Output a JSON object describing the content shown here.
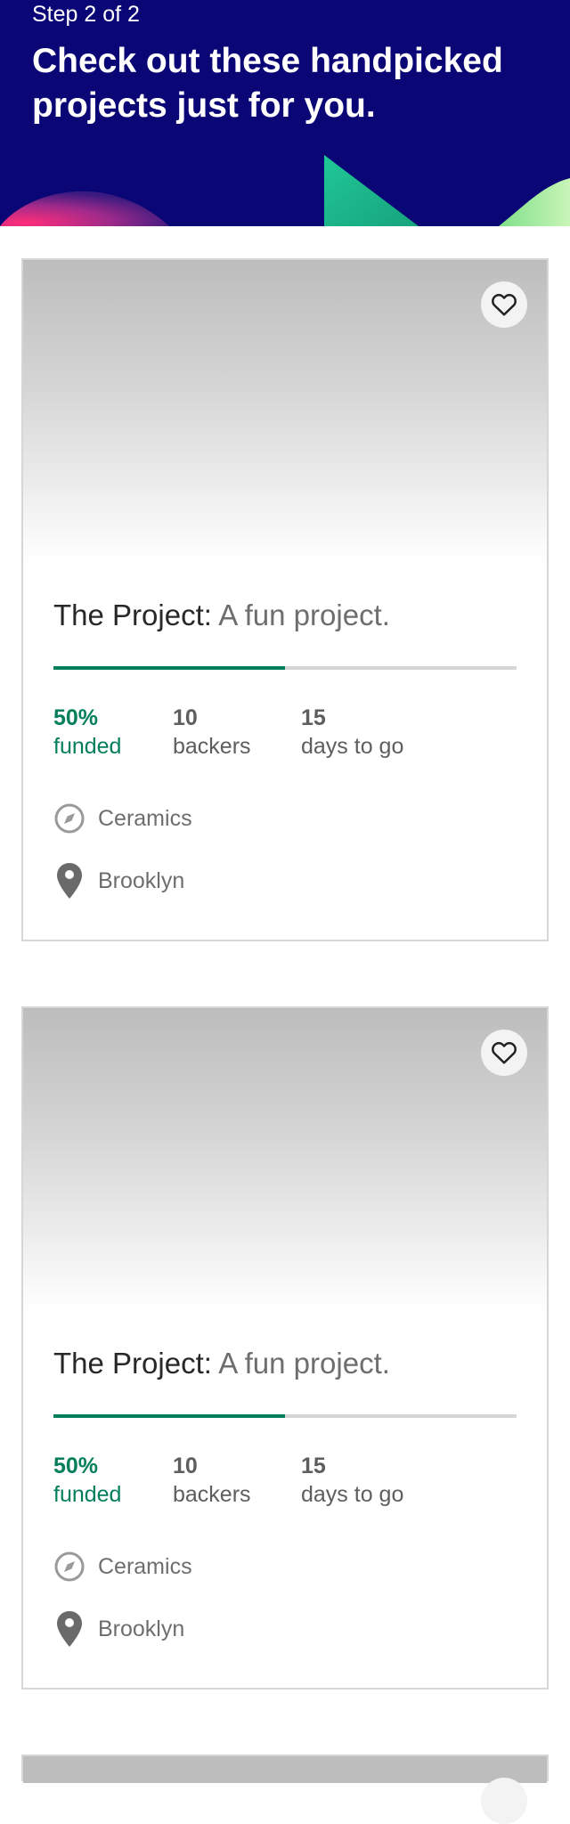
{
  "header": {
    "step": "Step 2 of 2",
    "headline": "Check out these handpicked projects just for you.",
    "background_color": "#0a0675"
  },
  "colors": {
    "accent_green": "#047f5b",
    "muted_text": "#6e6e6e",
    "border": "#d6d6d6"
  },
  "projects": [
    {
      "name": "The Project:",
      "blurb": "A fun project.",
      "funded_percent": "50%",
      "funded_label": "funded",
      "funded_fraction": 0.5,
      "backers_count": "10",
      "backers_label": "backers",
      "days_count": "15",
      "days_label": "days to go",
      "category": "Ceramics",
      "category_icon": "compass-icon",
      "location": "Brooklyn",
      "location_icon": "map-pin-icon",
      "save_icon": "heart-icon"
    },
    {
      "name": "The Project:",
      "blurb": "A fun project.",
      "funded_percent": "50%",
      "funded_label": "funded",
      "funded_fraction": 0.5,
      "backers_count": "10",
      "backers_label": "backers",
      "days_count": "15",
      "days_label": "days to go",
      "category": "Ceramics",
      "category_icon": "compass-icon",
      "location": "Brooklyn",
      "location_icon": "map-pin-icon",
      "save_icon": "heart-icon"
    },
    {
      "save_icon": "heart-icon"
    }
  ]
}
